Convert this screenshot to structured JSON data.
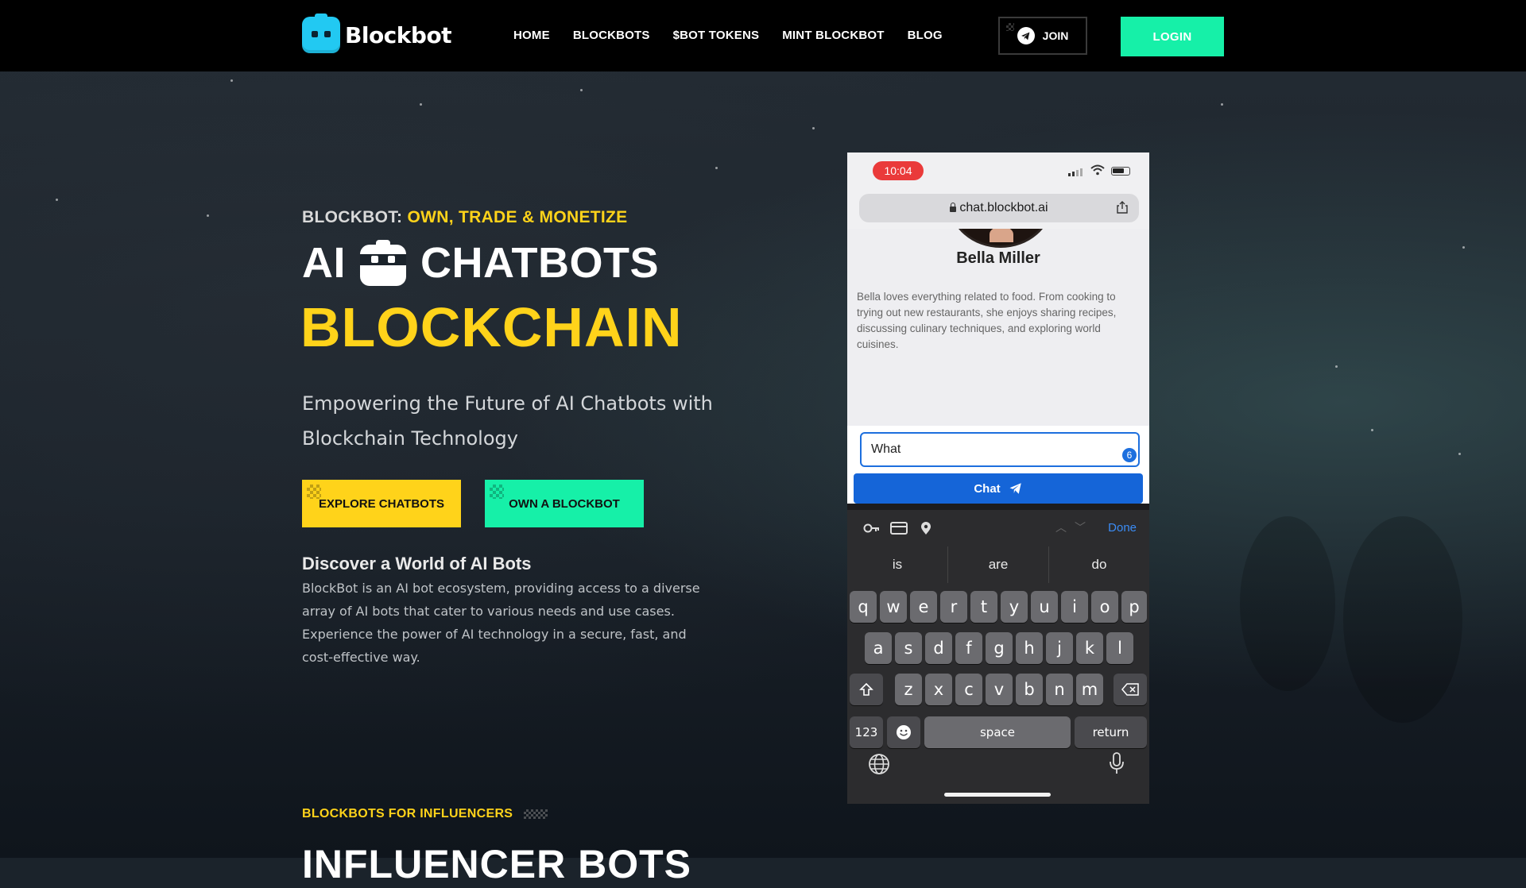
{
  "header": {
    "logo_text": "Blockbot",
    "nav": [
      "HOME",
      "BLOCKBOTS",
      "$BOT TOKENS",
      "MINT BLOCKBOT",
      "BLOG"
    ],
    "join_label": "JOIN",
    "login_label": "LOGIN"
  },
  "hero": {
    "kicker_white": "BLOCKBOT:",
    "kicker_yellow": "OWN, TRADE & MONETIZE",
    "line1_left": "AI",
    "line1_right": "CHATBOTS",
    "line2": "BLOCKCHAIN",
    "subtitle": "Empowering the Future of AI Chatbots with Blockchain Technology",
    "cta_explore": "EXPLORE CHATBOTS",
    "cta_own": "OWN A BLOCKBOT",
    "discover_title": "Discover a World of AI Bots",
    "discover_text": "BlockBot is an AI bot ecosystem, providing access to a diverse array of AI bots that cater to various needs and use cases. Experience the power of AI technology in a secure, fast, and cost-effective way."
  },
  "section": {
    "kicker": "BLOCKBOTS FOR INFLUENCERS",
    "title": "INFLUENCER BOTS"
  },
  "phone": {
    "time": "10:04",
    "url": "chat.blockbot.ai",
    "bot_name": "Bella Miller",
    "bot_description": "Bella loves everything related to food. From cooking to trying out new restaurants, she enjoys sharing recipes, discussing culinary techniques, and exploring world cuisines.",
    "input_value": "What ",
    "char_count": "6",
    "chat_button": "Chat",
    "done_label": "Done",
    "suggestions": [
      "is",
      "are",
      "do"
    ],
    "keyboard": {
      "row1": [
        "q",
        "w",
        "e",
        "r",
        "t",
        "y",
        "u",
        "i",
        "o",
        "p"
      ],
      "row2": [
        "a",
        "s",
        "d",
        "f",
        "g",
        "h",
        "j",
        "k",
        "l"
      ],
      "row3": [
        "z",
        "x",
        "c",
        "v",
        "b",
        "n",
        "m"
      ],
      "numbers_key": "123",
      "space_key": "space",
      "return_key": "return"
    }
  },
  "colors": {
    "yellow": "#ffd31a",
    "green": "#16f0a8",
    "blue": "#1565d8",
    "header_bg": "#000000"
  }
}
